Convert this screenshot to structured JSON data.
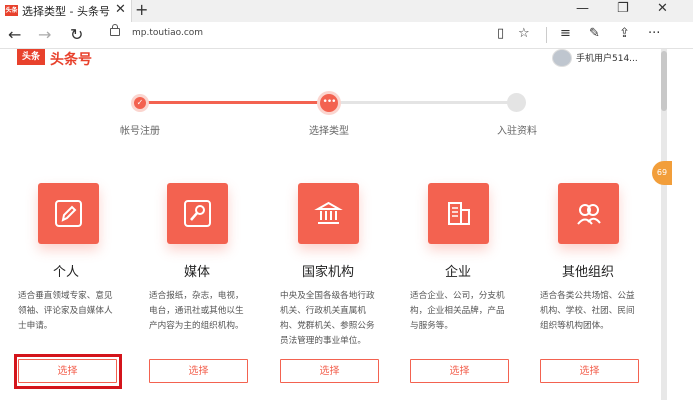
{
  "browser": {
    "tab_title": "选择类型 - 头条号",
    "favicon_text": "头条",
    "url": "mp.toutiao.com"
  },
  "header": {
    "logo_badge": "头条",
    "logo_text": "头条号",
    "user_name": "手机用户514..."
  },
  "float_badge": "69",
  "steps": [
    {
      "label": "帐号注册",
      "state": "done"
    },
    {
      "label": "选择类型",
      "state": "current"
    },
    {
      "label": "入驻资料",
      "state": "todo"
    }
  ],
  "cards": [
    {
      "icon": "pen-icon",
      "title": "个人",
      "desc": "适合垂直领域专家、意见领袖、评论家及自媒体人士申请。",
      "button": "选择"
    },
    {
      "icon": "microphone-icon",
      "title": "媒体",
      "desc": "适合报纸，杂志，电视，电台，通讯社或其他以生产内容为主的组织机构。",
      "button": "选择"
    },
    {
      "icon": "institution-icon",
      "title": "国家机构",
      "desc": "中央及全国各级各地行政机关、行政机关直属机构、党群机关、参照公务员法管理的事业单位。",
      "button": "选择"
    },
    {
      "icon": "building-icon",
      "title": "企业",
      "desc": "适合企业、公司，分支机构，企业相关品牌，产品与服务等。",
      "button": "选择"
    },
    {
      "icon": "people-icon",
      "title": "其他组织",
      "desc": "适合各类公共场馆、公益机构、学校、社团、民间组织等机构团体。",
      "button": "选择"
    }
  ],
  "colors": {
    "accent": "#f36250",
    "highlight": "#d4141b"
  }
}
